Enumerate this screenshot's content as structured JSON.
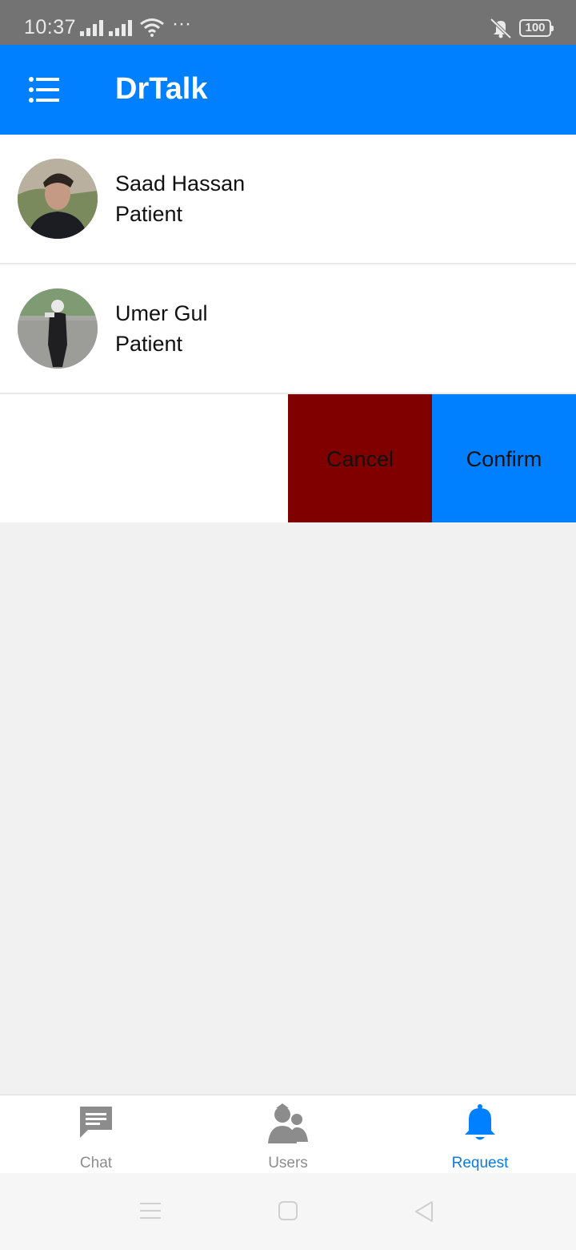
{
  "status_bar": {
    "time": "10:37",
    "dots": "···",
    "battery": "100"
  },
  "app_bar": {
    "title": "DrTalk",
    "color": "#0080ff"
  },
  "requests": [
    {
      "name": "Saad Hassan",
      "role": "Patient"
    },
    {
      "name": "Umer Gul",
      "role": "Patient"
    }
  ],
  "swipe_actions": {
    "cancel_label": "Cancel",
    "confirm_label": "Confirm",
    "cancel_color": "#800000",
    "confirm_color": "#0080ff"
  },
  "tabs": [
    {
      "label": "Chat",
      "icon": "chat-icon",
      "active": false
    },
    {
      "label": "Users",
      "icon": "users-icon",
      "active": false
    },
    {
      "label": "Request",
      "icon": "bell-icon",
      "active": true
    }
  ],
  "system_nav": {
    "icons": [
      "menu-icon",
      "home-icon",
      "back-icon"
    ]
  }
}
